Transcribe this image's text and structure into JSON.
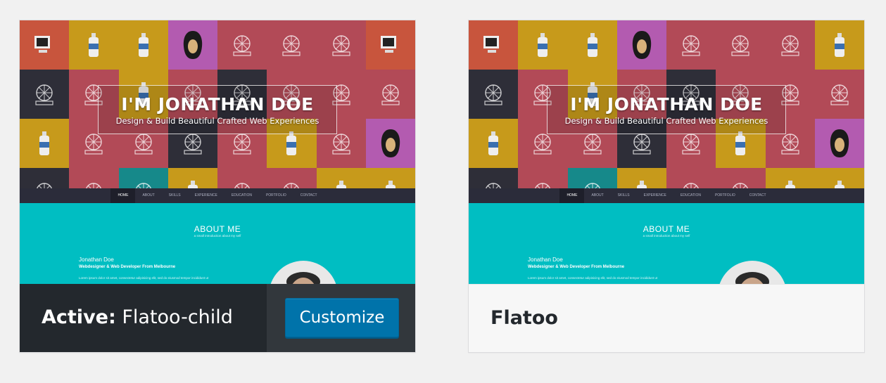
{
  "themes": [
    {
      "status": "active",
      "label_prefix": "Active:",
      "name": "Flatoo-child",
      "action_button": "Customize"
    },
    {
      "status": "inactive",
      "name": "Flatoo"
    }
  ],
  "preview": {
    "hero_title": "I'M JONATHAN DOE",
    "hero_subtitle": "Design & Build Beautiful Crafted Web Experiences",
    "nav": [
      "HOME",
      "ABOUT",
      "SKILLS",
      "EXPERIENCE",
      "EDUCATION",
      "PORTFOLIO",
      "CONTACT"
    ],
    "about_title": "ABOUT ME",
    "about_subtitle": "a small introduction about my self",
    "about_name": "Jonathan Doe",
    "about_role": "Webdesigner & Web Developer From Melbourne",
    "about_lorem": "Lorem ipsum dolor sit amet, consectetur adipisicing elit, sed do eiusmod tempor incididunt ut"
  },
  "colors": {
    "accent": "#0073aa",
    "about_bg": "#00bec2",
    "nav_bg": "#2b2c3a",
    "active_footer": "#23282d"
  }
}
